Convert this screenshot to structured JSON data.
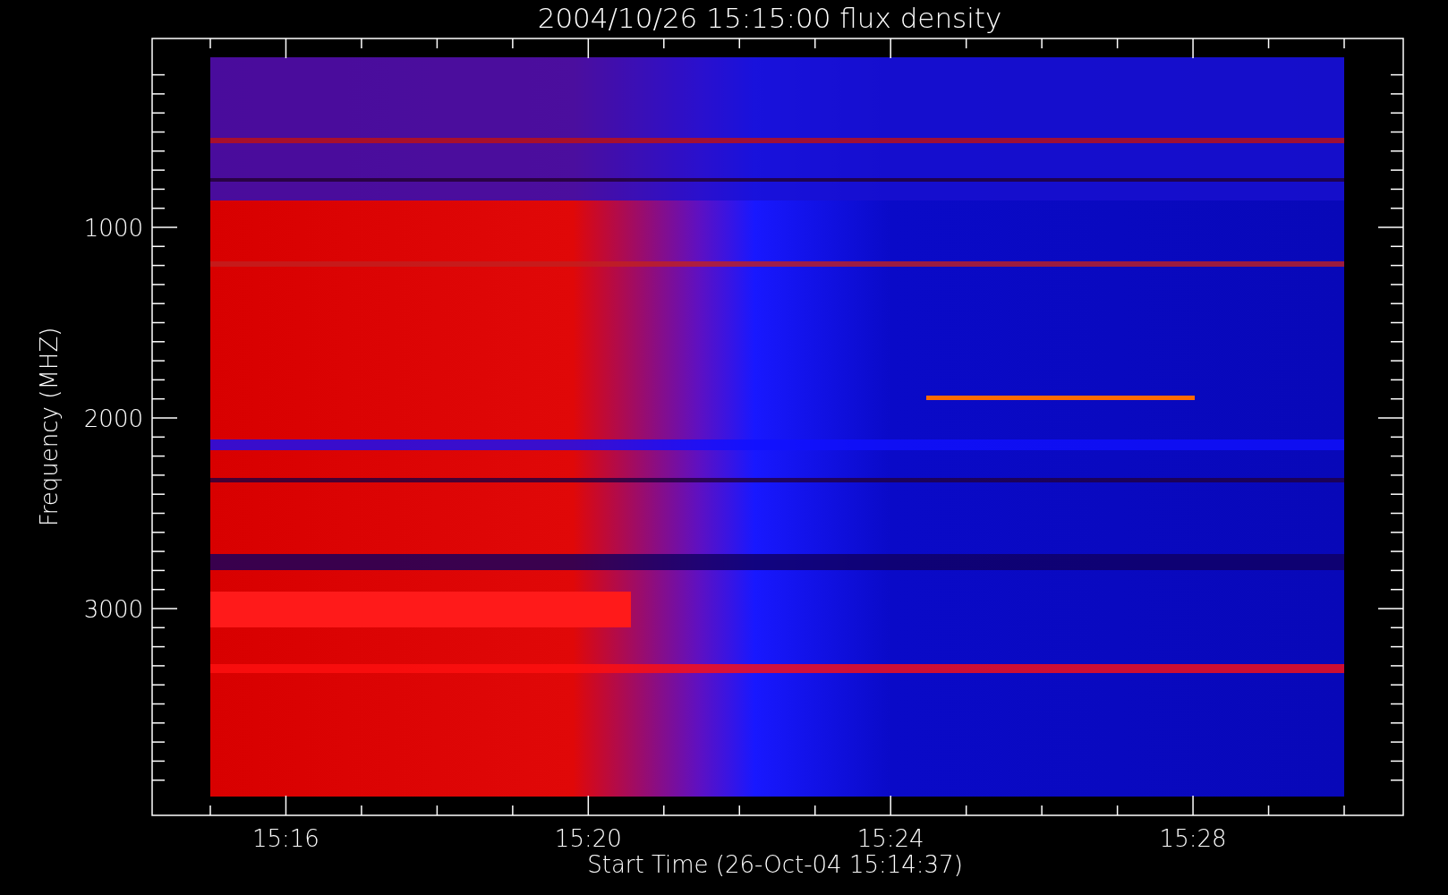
{
  "plot": {
    "title": "2004/10/26 15:15:00 flux density",
    "xlabel": "Start Time (26-Oct-04 15:14:37)",
    "ylabel": "Frequency (MHZ)",
    "xtick_labels": [
      "15:16",
      "15:20",
      "15:24",
      "15:28"
    ],
    "ytick_labels": [
      "1000",
      "2000",
      "3000"
    ]
  }
}
